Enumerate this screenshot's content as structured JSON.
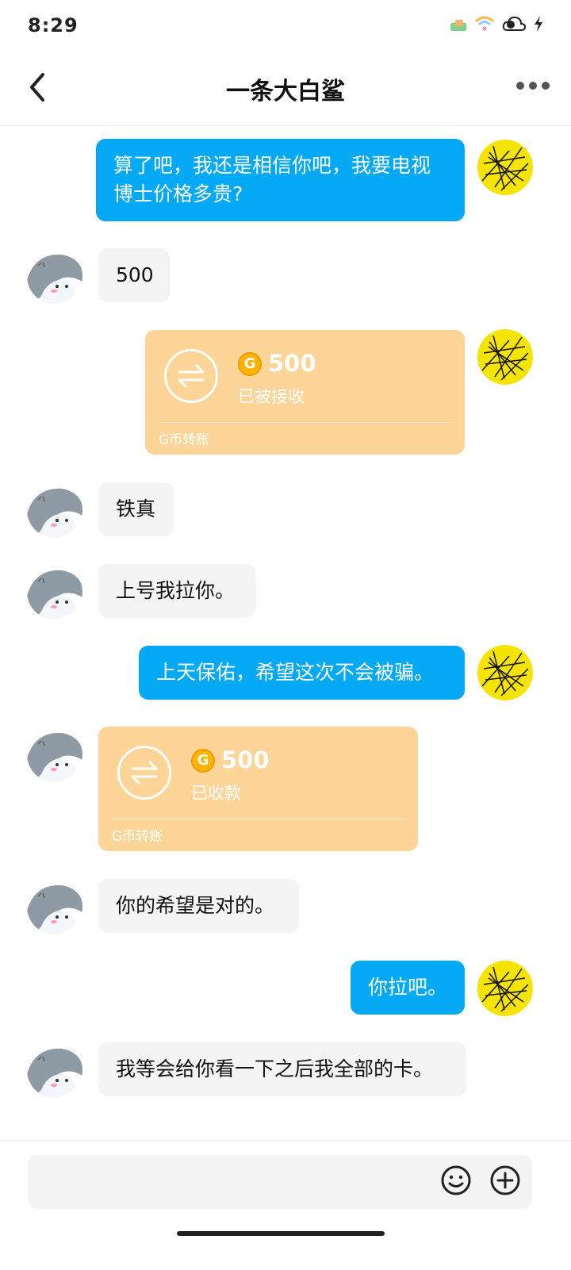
{
  "status_bar": {
    "time": "8:29",
    "icons": [
      "sim-card-icon",
      "wifi-icon",
      "cloud-sync-icon",
      "charging-bolt-icon"
    ]
  },
  "header": {
    "title": "一条大白鲨",
    "back_icon": "chevron-left-icon",
    "more_icon": "more-dots-icon"
  },
  "messages": [
    {
      "side": "right",
      "type": "text",
      "text": "算了吧，我还是相信你吧，我要电视博士价格多贵?"
    },
    {
      "side": "left",
      "type": "text",
      "text": "500"
    },
    {
      "side": "right",
      "type": "transfer",
      "amount": "500",
      "status": "已被接收",
      "label": "G币转账"
    },
    {
      "side": "left",
      "type": "text",
      "text": "铁真"
    },
    {
      "side": "left",
      "type": "text",
      "text": "上号我拉你。"
    },
    {
      "side": "right",
      "type": "text",
      "text": "上天保佑，希望这次不会被骗。"
    },
    {
      "side": "left",
      "type": "transfer",
      "amount": "500",
      "status": "已收款",
      "label": "G币转账"
    },
    {
      "side": "left",
      "type": "text",
      "text": "你的希望是对的。"
    },
    {
      "side": "right",
      "type": "text",
      "text": "你拉吧。"
    },
    {
      "side": "left",
      "type": "text",
      "text": "我等会给你看一下之后我全部的卡。"
    }
  ],
  "coin_symbol": "G",
  "input_bar": {
    "value": "",
    "emoji_icon": "emoji-smile-icon",
    "plus_icon": "plus-circle-icon"
  },
  "colors": {
    "outgoing_bubble": "#03a9f4",
    "incoming_bubble": "#f4f4f4",
    "transfer_card": "#fdd598",
    "coin": "#ffb400"
  }
}
